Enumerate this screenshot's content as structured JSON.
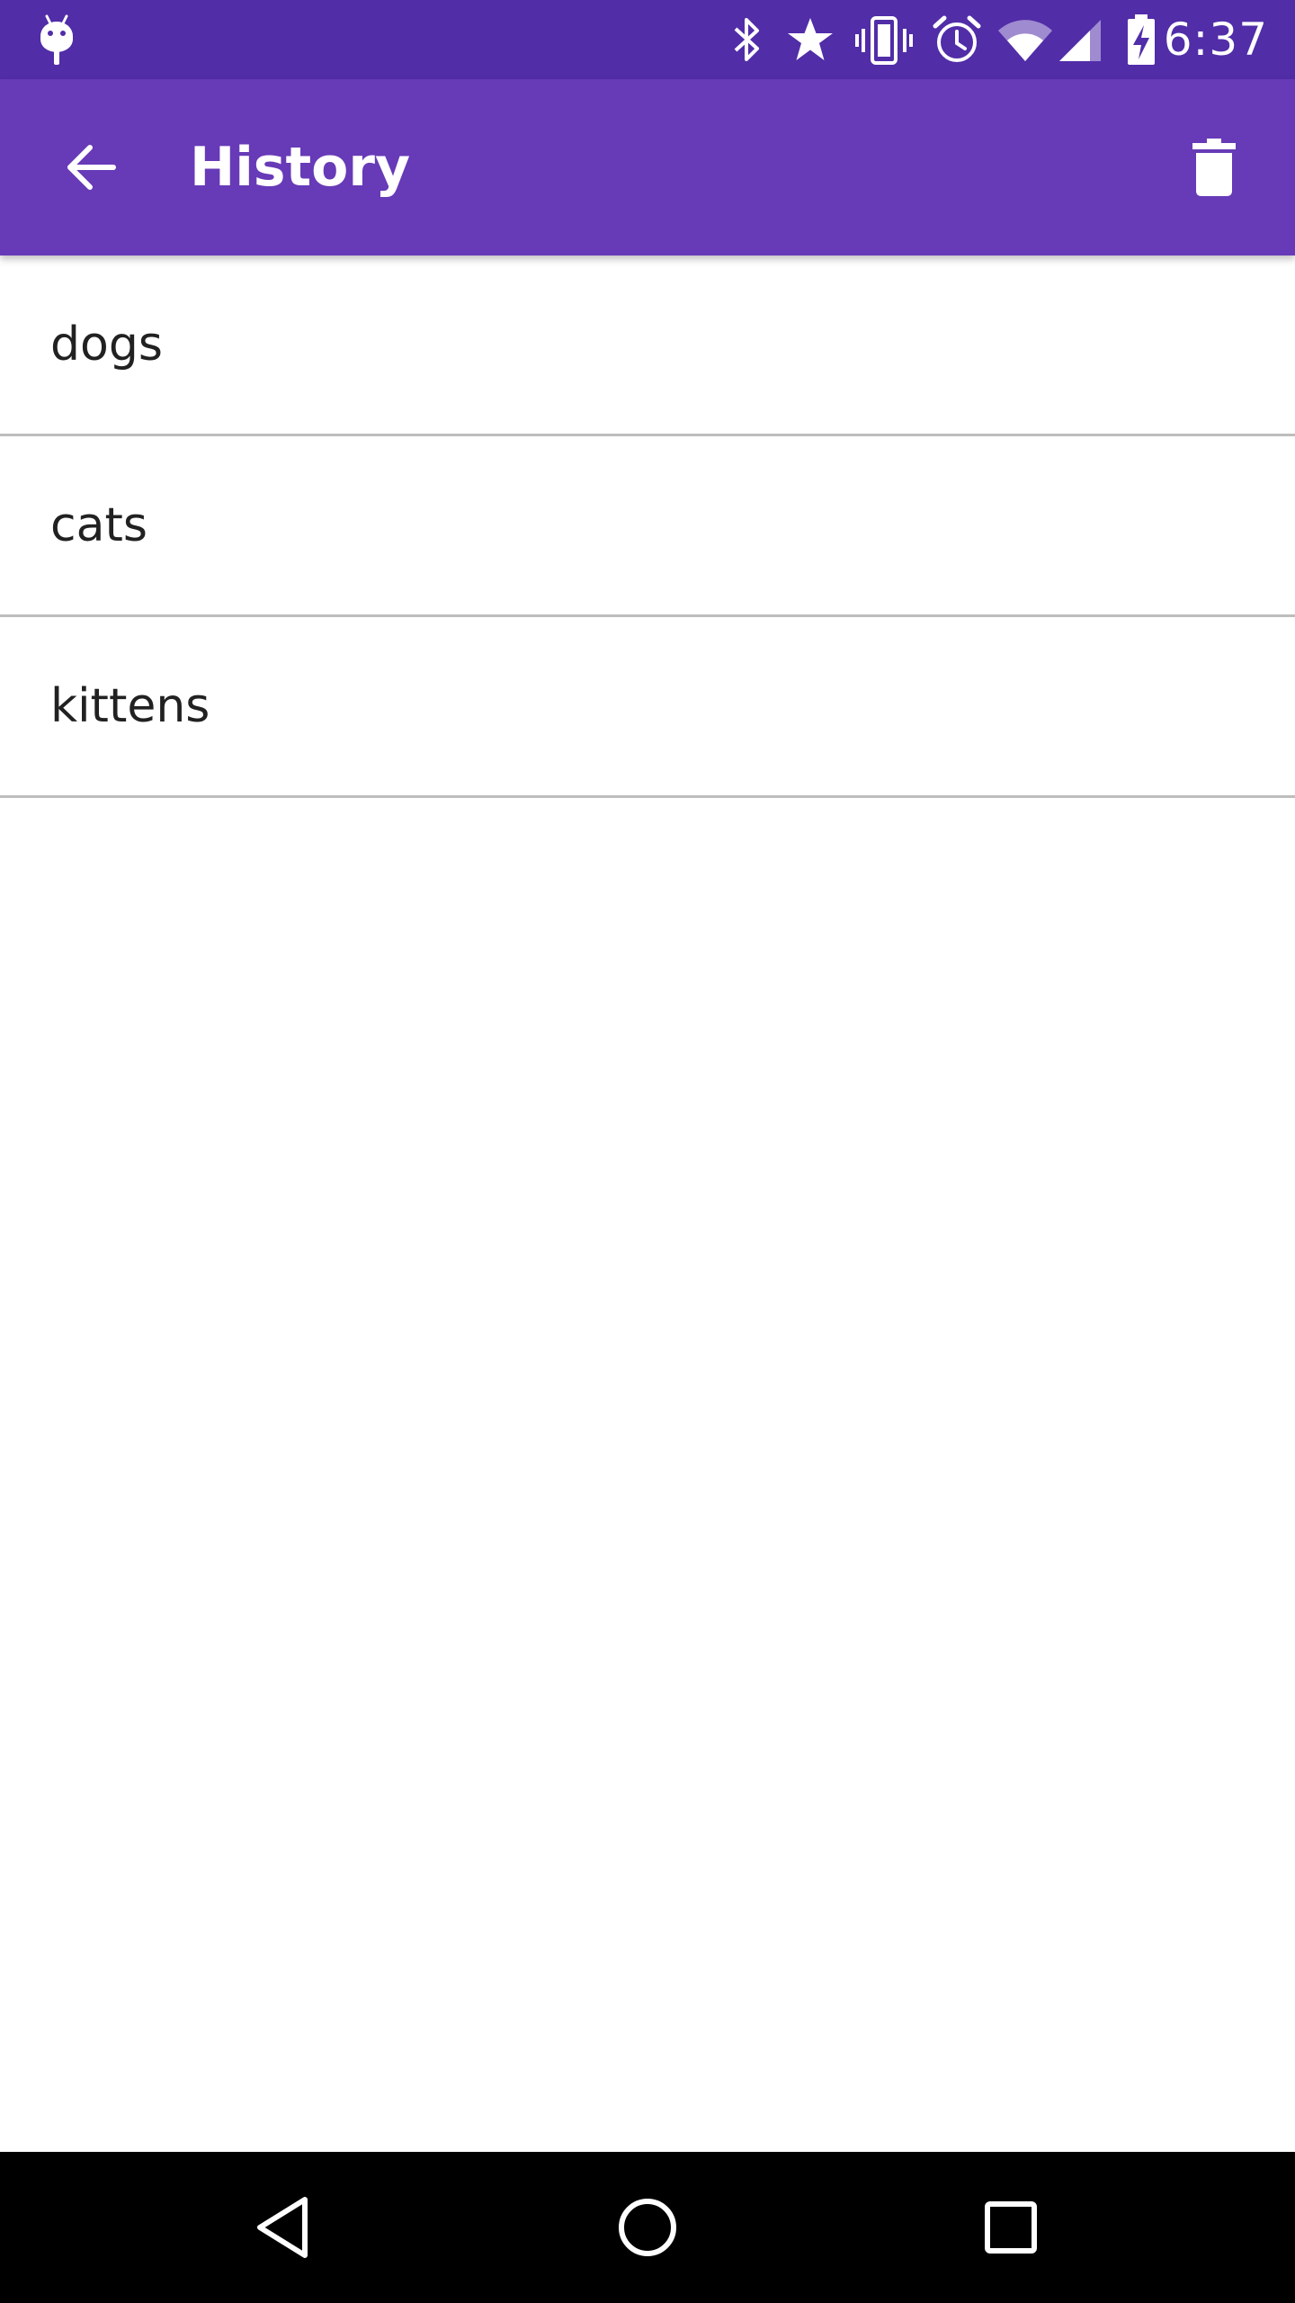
{
  "status_bar": {
    "time": "6:37",
    "icons": [
      "android-debug-icon",
      "bluetooth-icon",
      "star-icon",
      "vibrate-icon",
      "alarm-icon",
      "wifi-icon",
      "cell-signal-icon",
      "battery-charging-icon"
    ],
    "background_color": "#512da8"
  },
  "app_bar": {
    "title": "History",
    "back_icon": "arrow-back-icon",
    "delete_icon": "trash-icon",
    "background_color": "#673ab7"
  },
  "history": {
    "items": [
      {
        "label": "dogs"
      },
      {
        "label": "cats"
      },
      {
        "label": "kittens"
      }
    ]
  },
  "nav_bar": {
    "buttons": [
      "back-triangle-icon",
      "home-circle-icon",
      "recents-square-icon"
    ]
  }
}
